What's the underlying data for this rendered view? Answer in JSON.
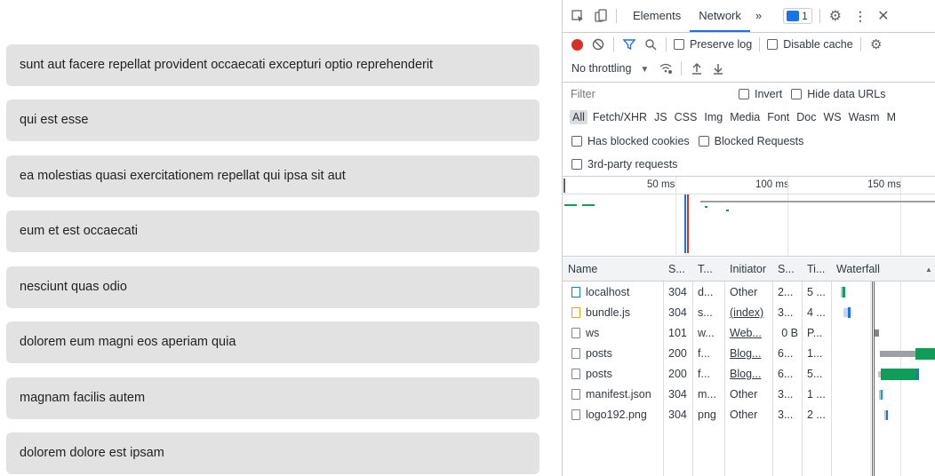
{
  "posts": [
    "sunt aut facere repellat provident occaecati excepturi optio reprehenderit",
    "qui est esse",
    "ea molestias quasi exercitationem repellat qui ipsa sit aut",
    "eum et est occaecati",
    "nesciunt quas odio",
    "dolorem eum magni eos aperiam quia",
    "magnam facilis autem",
    "dolorem dolore est ipsam"
  ],
  "devtools": {
    "tabs": {
      "elements": "Elements",
      "network": "Network",
      "more": "»",
      "issues_count": "1"
    },
    "toolbar": {
      "preserve_log": "Preserve log",
      "disable_cache": "Disable cache",
      "throttling": "No throttling"
    },
    "filter": {
      "placeholder": "Filter",
      "invert": "Invert",
      "hide_data_urls": "Hide data URLs"
    },
    "types": [
      "All",
      "Fetch/XHR",
      "JS",
      "CSS",
      "Img",
      "Media",
      "Font",
      "Doc",
      "WS",
      "Wasm",
      "M"
    ],
    "blocked_cookies": "Has blocked cookies",
    "blocked_requests": "Blocked Requests",
    "third_party": "3rd-party requests",
    "overview_ticks": [
      "50 ms",
      "100 ms",
      "150 ms"
    ],
    "columns": [
      "Name",
      "S...",
      "T...",
      "Initiator",
      "S...",
      "Ti...",
      "Waterfall"
    ],
    "requests": [
      {
        "name": "localhost",
        "status": "304",
        "type": "d...",
        "initiator": "Other",
        "size": "2...",
        "time": "5 ..."
      },
      {
        "name": "bundle.js",
        "status": "304",
        "type": "s...",
        "initiator": "(index)",
        "size": "3...",
        "time": "4 ..."
      },
      {
        "name": "ws",
        "status": "101",
        "type": "w...",
        "initiator": "Web...",
        "size": "0 B",
        "time": "P..."
      },
      {
        "name": "posts",
        "status": "200",
        "type": "f...",
        "initiator": "Blog...",
        "size": "6...",
        "time": "1..."
      },
      {
        "name": "posts",
        "status": "200",
        "type": "f...",
        "initiator": "Blog...",
        "size": "6...",
        "time": "5..."
      },
      {
        "name": "manifest.json",
        "status": "304",
        "type": "m...",
        "initiator": "Other",
        "size": "3...",
        "time": "1 ..."
      },
      {
        "name": "logo192.png",
        "status": "304",
        "type": "png",
        "initiator": "Other",
        "size": "3...",
        "time": "2 ..."
      }
    ]
  }
}
